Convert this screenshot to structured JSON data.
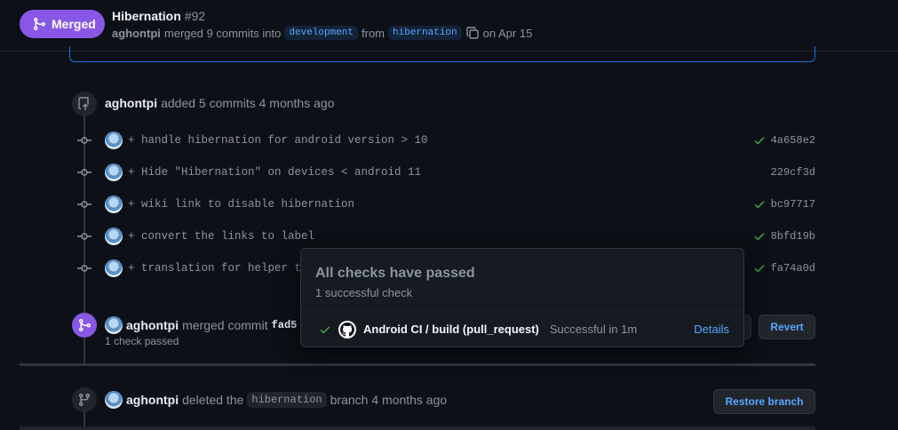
{
  "header": {
    "badge_label": "Merged",
    "title": "Hibernation",
    "number": "#92",
    "author": "aghontpi",
    "merged_text": "merged 9 commits into",
    "base_branch": "development",
    "from_text": "from",
    "head_branch": "hibernation",
    "date_text": "on Apr 15"
  },
  "commits_event": {
    "actor": "aghontpi",
    "text": "added 5 commits 4 months ago",
    "commits": [
      {
        "message": "+ handle hibernation for android version > 10",
        "sha": "4a658e2",
        "checked": true
      },
      {
        "message": "+ Hide \"Hibernation\" on devices < android 11",
        "sha": "229cf3d",
        "checked": false
      },
      {
        "message": "+ wiki link to disable hibernation",
        "sha": "bc97717",
        "checked": true
      },
      {
        "message": "+ convert the links to label",
        "sha": "8bfd19b",
        "checked": true
      },
      {
        "message": "+ translation for helper te",
        "sha": "fa74a0d",
        "checked": true
      }
    ]
  },
  "merge_event": {
    "actor": "aghontpi",
    "text": "merged commit",
    "sha": "fad5",
    "checks_passed": "1 check passed",
    "revert_label": "Revert"
  },
  "delete_event": {
    "actor": "aghontpi",
    "text_before": "deleted the",
    "branch": "hibernation",
    "text_after": "branch 4 months ago",
    "restore_label": "Restore branch"
  },
  "popover": {
    "title": "All checks have passed",
    "subtitle": "1 successful check",
    "check_name": "Android CI / build (pull_request)",
    "check_status": "Successful in 1m",
    "details_label": "Details"
  },
  "colors": {
    "merged": "#8957e5",
    "link": "#58a6ff",
    "success": "#3fb950",
    "background": "#0d1117"
  }
}
